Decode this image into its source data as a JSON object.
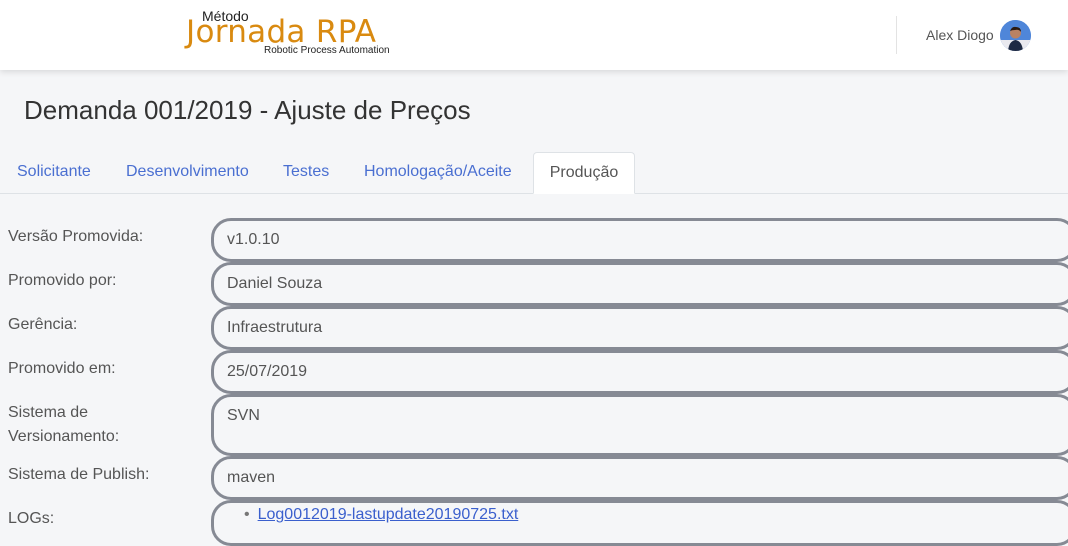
{
  "header": {
    "logo": {
      "metodo": "Método",
      "main": "Jornada RPA",
      "sub": "Robotic Process Automation"
    },
    "user": {
      "name": "Alex Diogo",
      "avatar_icon": "user-avatar"
    }
  },
  "page": {
    "title": "Demanda 001/2019 - Ajuste de Preços"
  },
  "tabs": [
    {
      "label": "Solicitante",
      "active": false
    },
    {
      "label": "Desenvolvimento",
      "active": false
    },
    {
      "label": "Testes",
      "active": false
    },
    {
      "label": "Homologação/Aceite",
      "active": false
    },
    {
      "label": "Produção",
      "active": true
    }
  ],
  "form": {
    "versao": {
      "label": "Versão Promovida:",
      "value": "v1.0.10"
    },
    "promovido_por": {
      "label": "Promovido por:",
      "value": "Daniel Souza"
    },
    "gerencia": {
      "label": "Gerência:",
      "value": "Infraestrutura"
    },
    "promovido_em": {
      "label": "Promovido em:",
      "value": "25/07/2019"
    },
    "versionamento": {
      "label_line1": "Sistema de",
      "label_line2": "Versionamento:",
      "value": "SVN"
    },
    "publish": {
      "label": "Sistema de Publish:",
      "value": "maven"
    },
    "logs": {
      "label": "LOGs:",
      "items": [
        "Log0012019-lastupdate20190725.txt"
      ]
    }
  },
  "colors": {
    "accent": "#4a6fd1",
    "logo": "#d98a10",
    "field_border": "#868a94"
  }
}
